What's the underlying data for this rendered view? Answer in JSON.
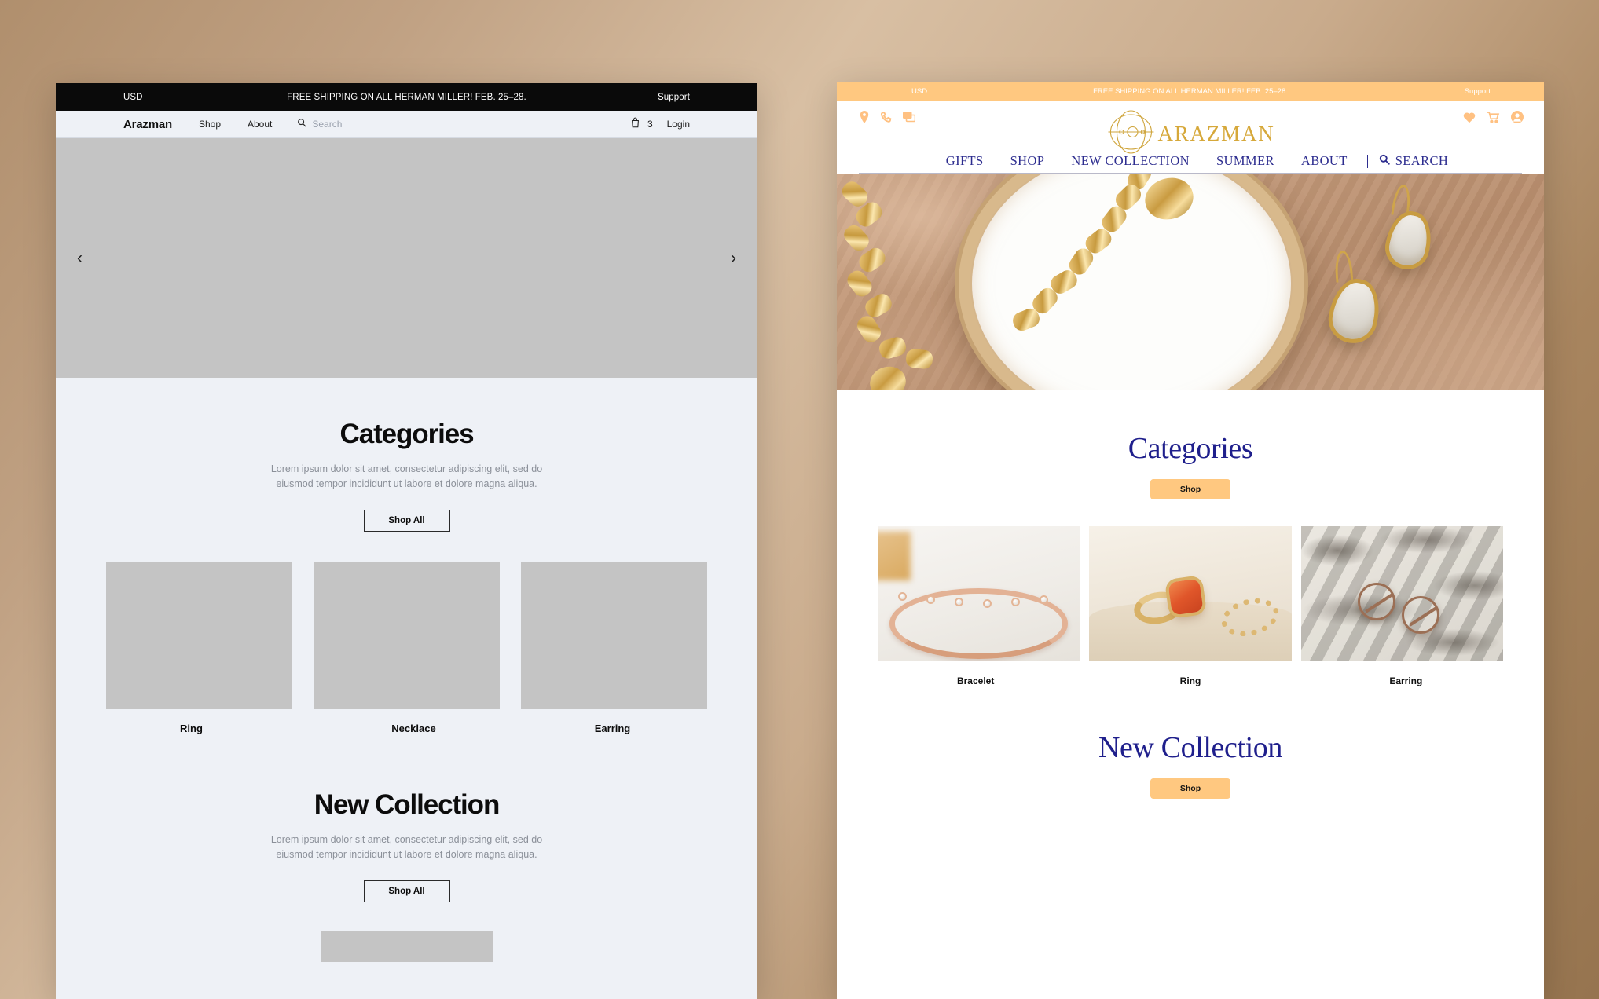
{
  "wireframe": {
    "topbar": {
      "currency": "USD",
      "promo": "FREE SHIPPING ON ALL HERMAN MILLER! FEB. 25–28.",
      "support": "Support"
    },
    "nav": {
      "brand": "Arazman",
      "links": [
        "Shop",
        "About"
      ],
      "search_placeholder": "Search",
      "cart_count": "3",
      "login": "Login"
    },
    "hero": {
      "prev_arrow": "‹",
      "next_arrow": "›"
    },
    "categories": {
      "heading": "Categories",
      "subtitle": "Lorem ipsum dolor sit amet, consectetur adipiscing elit, sed do eiusmod tempor incididunt ut labore et dolore magna aliqua.",
      "button": "Shop All",
      "cards": [
        {
          "label": "Ring"
        },
        {
          "label": "Necklace"
        },
        {
          "label": "Earring"
        }
      ]
    },
    "new_collection": {
      "heading": "New Collection",
      "subtitle": "Lorem ipsum dolor sit amet, consectetur adipiscing elit, sed do eiusmod tempor incididunt ut labore et dolore magna aliqua.",
      "button": "Shop All"
    }
  },
  "mockup": {
    "topbar": {
      "currency": "USD",
      "promo": "FREE SHIPPING ON ALL HERMAN MILLER! FEB. 25–28.",
      "support": "Support"
    },
    "header": {
      "logo_text": "ARAZMAN",
      "util_left_icons": [
        "location-pin-icon",
        "phone-icon",
        "chat-icon"
      ],
      "util_right_icons": [
        "heart-icon",
        "cart-icon",
        "account-icon"
      ],
      "nav_links": [
        "GIFTS",
        "SHOP",
        "NEW COLLECTION",
        "SUMMER",
        "ABOUT"
      ],
      "search_label": "SEARCH"
    },
    "categories": {
      "heading": "Categories",
      "button": "Shop",
      "cards": [
        {
          "label": "Bracelet"
        },
        {
          "label": "Ring"
        },
        {
          "label": "Earring"
        }
      ]
    },
    "new_collection": {
      "heading": "New Collection",
      "button": "Shop"
    }
  },
  "colors": {
    "page_background_tan": "#b98f67",
    "wireframe_bg": "#eef1f6",
    "wireframe_topbar": "#0a0a0a",
    "wireframe_placeholder": "#c4c4c4",
    "mockup_orange": "#ffc880",
    "mockup_navy": "#1f1f8c",
    "mockup_gold": "#d6a83a"
  }
}
